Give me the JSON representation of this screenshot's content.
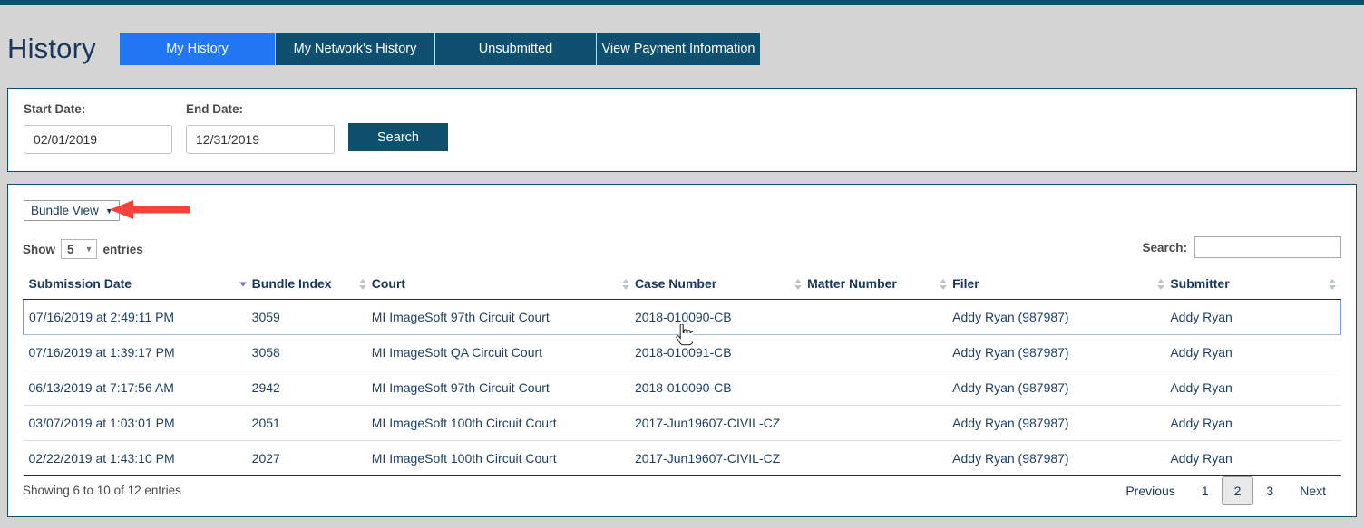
{
  "header": {
    "title": "History",
    "tabs": [
      {
        "label": "My History",
        "active": true
      },
      {
        "label": "My Network's History",
        "active": false
      },
      {
        "label": "Unsubmitted",
        "active": false
      },
      {
        "label": "View Payment Information",
        "active": false
      }
    ]
  },
  "search_panel": {
    "start_date_label": "Start Date:",
    "start_date_value": "02/01/2019",
    "start_date_placeholder": "mm/dd/yyyy",
    "end_date_label": "End Date:",
    "end_date_value": "12/31/2019",
    "end_date_placeholder": "mm/dd/yyyy",
    "search_button": "Search"
  },
  "table_panel": {
    "view_select_value": "Bundle View",
    "view_select_caret": "▼",
    "show_prefix": "Show",
    "entries_value": "5",
    "entries_caret": "▼",
    "show_suffix": "entries",
    "search_label": "Search:",
    "search_value": "",
    "search_placeholder": "",
    "columns": [
      {
        "label": "Submission Date",
        "sort": "desc"
      },
      {
        "label": "Bundle Index",
        "sort": "none"
      },
      {
        "label": "Court",
        "sort": "none"
      },
      {
        "label": "Case Number",
        "sort": "none"
      },
      {
        "label": "Matter Number",
        "sort": "none"
      },
      {
        "label": "Filer",
        "sort": "none"
      },
      {
        "label": "Submitter",
        "sort": "none"
      }
    ],
    "rows": [
      {
        "submission_date": "07/16/2019 at 2:49:11 PM",
        "bundle_index": "3059",
        "court": "MI ImageSoft 97th Circuit Court",
        "case_number": "2018-010090-CB",
        "matter_number": "",
        "filer": "Addy Ryan (987987)",
        "submitter": "Addy Ryan",
        "hovered": true
      },
      {
        "submission_date": "07/16/2019 at 1:39:17 PM",
        "bundle_index": "3058",
        "court": "MI ImageSoft QA Circuit Court",
        "case_number": "2018-010091-CB",
        "matter_number": "",
        "filer": "Addy Ryan (987987)",
        "submitter": "Addy Ryan",
        "hovered": false
      },
      {
        "submission_date": "06/13/2019 at 7:17:56 AM",
        "bundle_index": "2942",
        "court": "MI ImageSoft 97th Circuit Court",
        "case_number": "2018-010090-CB",
        "matter_number": "",
        "filer": "Addy Ryan (987987)",
        "submitter": "Addy Ryan",
        "hovered": false
      },
      {
        "submission_date": "03/07/2019 at 1:03:01 PM",
        "bundle_index": "2051",
        "court": "MI ImageSoft 100th Circuit Court",
        "case_number": "2017-Jun19607-CIVIL-CZ",
        "matter_number": "",
        "filer": "Addy Ryan (987987)",
        "submitter": "Addy Ryan",
        "hovered": false
      },
      {
        "submission_date": "02/22/2019 at 1:43:10 PM",
        "bundle_index": "2027",
        "court": "MI ImageSoft 100th Circuit Court",
        "case_number": "2017-Jun19607-CIVIL-CZ",
        "matter_number": "",
        "filer": "Addy Ryan (987987)",
        "submitter": "Addy Ryan",
        "hovered": false
      }
    ],
    "showing_info": "Showing 6 to 10 of 12 entries",
    "pagination": {
      "previous": "Previous",
      "pages": [
        "1",
        "2",
        "3"
      ],
      "active_page": "2",
      "next": "Next"
    }
  },
  "annotation": {
    "arrow_color": "#f9423a",
    "points_to": "Bundle View"
  },
  "colors": {
    "page_background": "#d4d4d4",
    "panel_border": "#0f5070",
    "tab_inactive": "#0f5070",
    "tab_active": "#2277f5",
    "search_button": "#10506f",
    "text_blue": "#17375e",
    "sort_active": "#7b6fd6"
  }
}
